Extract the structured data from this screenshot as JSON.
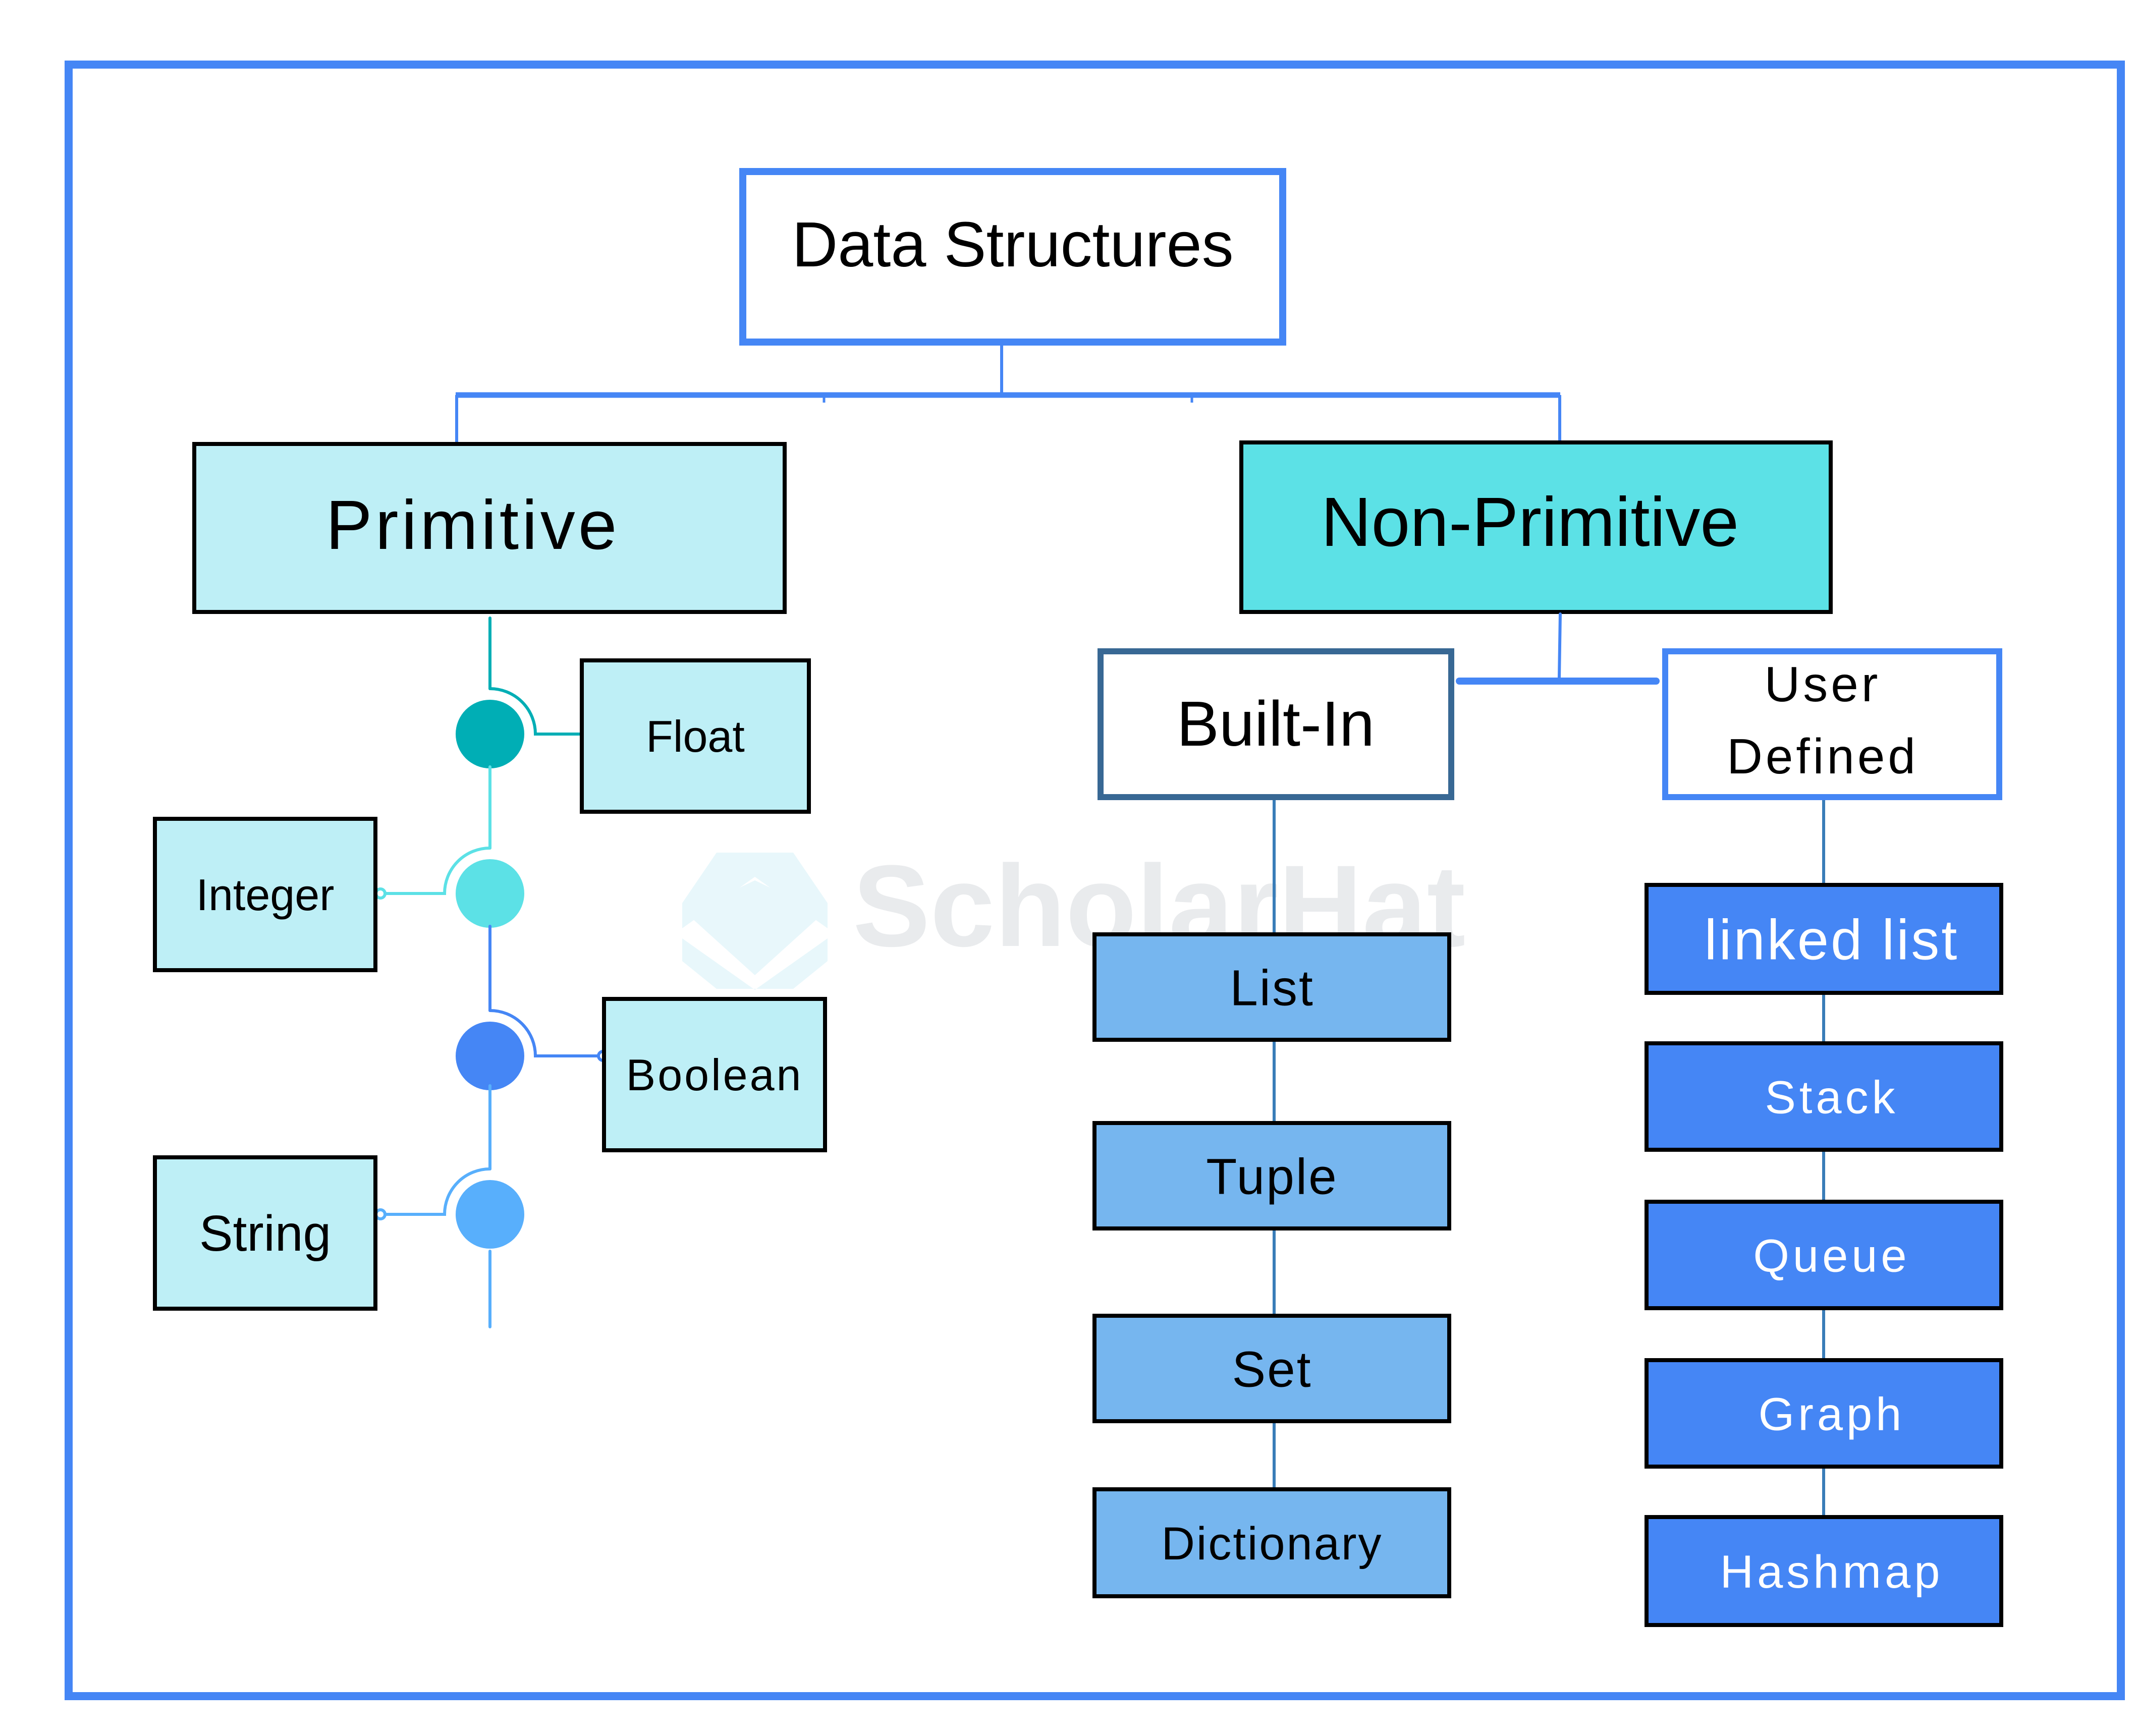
{
  "colors": {
    "frame": "#4586F5",
    "root_border": "#4586F5",
    "primitive_fill": "#BEEFF6",
    "non_primitive_fill": "#5CE1E6",
    "builtin_border": "#386894",
    "user_defined_border": "#4586F5",
    "builtin_item_fill": "#76B6EF",
    "user_item_fill": "#4586F5",
    "connector_blue": "#4586F5",
    "connector_steel": "#3A7DB8",
    "dot_float": "#00AEB5",
    "dot_integer": "#5CE1E6",
    "dot_boolean": "#4586F5",
    "dot_string": "#58AFFC",
    "watermark_text": "#E9EBED",
    "watermark_logo": "#E8F7FB",
    "box_border": "#000000",
    "text_dark": "#000000",
    "text_light": "#FFFFFF"
  },
  "root": {
    "label": "Data Structures"
  },
  "primitive": {
    "label": "Primitive",
    "children": [
      {
        "label": "Float",
        "side": "right"
      },
      {
        "label": "Integer",
        "side": "left"
      },
      {
        "label": "Boolean",
        "side": "right"
      },
      {
        "label": "String",
        "side": "left"
      }
    ]
  },
  "non_primitive": {
    "label": "Non-Primitive",
    "built_in": {
      "label": "Built-In",
      "children": [
        "List",
        "Tuple",
        "Set",
        "Dictionary"
      ]
    },
    "user_defined": {
      "label_lines": [
        "User",
        "Defined"
      ],
      "children": [
        "linked list",
        "Stack",
        "Queue",
        "Graph",
        "Hashmap"
      ]
    }
  },
  "watermark": {
    "text": "ScholarHat",
    "icon": "scholarhat-logo-icon"
  }
}
